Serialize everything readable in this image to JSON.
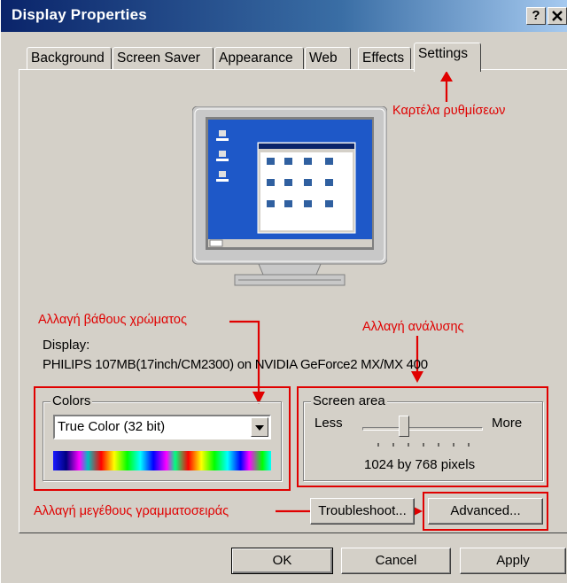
{
  "window": {
    "title": "Display Properties",
    "help_button": "?",
    "close_button": "x"
  },
  "tabs": [
    {
      "label": "Background"
    },
    {
      "label": "Screen Saver"
    },
    {
      "label": "Appearance"
    },
    {
      "label": "Web"
    },
    {
      "label": "Effects"
    },
    {
      "label": "Settings"
    }
  ],
  "annotations": {
    "settings_tab": "Καρτέλα ρυθμίσεων",
    "color_depth": "Αλλαγή βάθους χρώματος",
    "resolution": "Αλλαγή ανάλυσης",
    "font_size": "Αλλαγή μεγέθους γραμματοσειράς"
  },
  "display": {
    "label": "Display:",
    "device": "PHILIPS 107MB(17inch/CM2300) on NVIDIA GeForce2 MX/MX 400"
  },
  "colors": {
    "group_label": "Colors",
    "selected": "True Color (32 bit)"
  },
  "screen_area": {
    "group_label": "Screen area",
    "less": "Less",
    "more": "More",
    "resolution_text": "1024 by 768 pixels",
    "slider_position": 0.33
  },
  "buttons": {
    "troubleshoot": "Troubleshoot...",
    "advanced": "Advanced...",
    "ok": "OK",
    "cancel": "Cancel",
    "apply": "Apply"
  },
  "colors_palette": {
    "annotation_red": "#e00000",
    "dialog_face": "#d4d0c8",
    "title_bar": "#0a246a",
    "desktop_blue": "#1e58c8"
  }
}
